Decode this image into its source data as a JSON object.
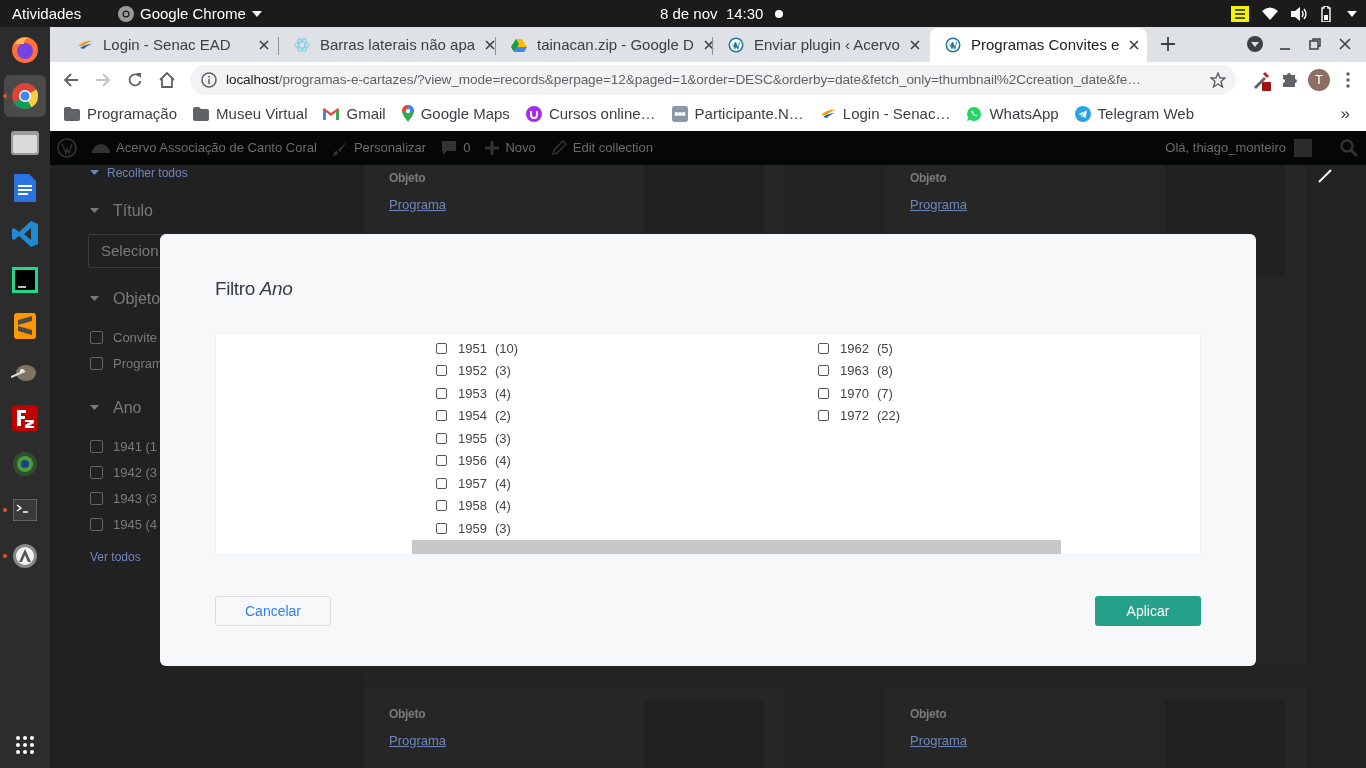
{
  "top_bar": {
    "activities": "Atividades",
    "app": "Google Chrome",
    "clock": "8 de nov  14:30"
  },
  "dock": [
    {
      "kind": "firefox",
      "selected": false,
      "running": false
    },
    {
      "kind": "chrome",
      "selected": true,
      "running": true
    },
    {
      "kind": "files",
      "selected": false,
      "running": false
    },
    {
      "kind": "docs",
      "selected": false,
      "running": false
    },
    {
      "kind": "vscode",
      "selected": false,
      "running": false
    },
    {
      "kind": "pycharm",
      "selected": false,
      "running": false
    },
    {
      "kind": "sublime",
      "selected": false,
      "running": false
    },
    {
      "kind": "gimp",
      "selected": false,
      "running": false
    },
    {
      "kind": "filezilla",
      "selected": false,
      "running": false
    },
    {
      "kind": "globe",
      "selected": false,
      "running": false
    },
    {
      "kind": "terminal",
      "selected": false,
      "running": true
    },
    {
      "kind": "updater",
      "selected": false,
      "running": true
    },
    {
      "kind": "apps",
      "selected": false,
      "running": false
    }
  ],
  "browser": {
    "tabs": [
      {
        "kind": "senac",
        "title": "Login - Senac EAD",
        "selected": false
      },
      {
        "kind": "react",
        "title": "Barras laterais não apa",
        "selected": false
      },
      {
        "kind": "drive",
        "title": "tainacan.zip - Google D",
        "selected": false
      },
      {
        "kind": "wordpress",
        "title": "Enviar plugin ‹ Acervo",
        "selected": false
      },
      {
        "kind": "wordpress",
        "title": "Programas Convites e",
        "selected": true
      }
    ],
    "url": {
      "host": "localhost",
      "path": "/programas-e-cartazes/?view_mode=records&perpage=12&paged=1&order=DESC&orderby=date&fetch_only=thumbnail%2Ccreation_date&fe…"
    },
    "avatar": "T",
    "bookmarks": [
      {
        "kind": "folder",
        "label": "Programação"
      },
      {
        "kind": "folder",
        "label": "Museu Virtual"
      },
      {
        "kind": "gmail",
        "label": "Gmail"
      },
      {
        "kind": "maps",
        "label": "Google Maps"
      },
      {
        "kind": "courses",
        "label": "Cursos online…"
      },
      {
        "kind": "meeting",
        "label": "Participante.N…"
      },
      {
        "kind": "senac",
        "label": "Login - Senac…"
      },
      {
        "kind": "whatsapp",
        "label": "WhatsApp"
      },
      {
        "kind": "telegram",
        "label": "Telegram Web"
      }
    ],
    "more": "»"
  },
  "admin_bar": {
    "site": "Acervo Associação de Canto Coral",
    "customize": "Personalizar",
    "comments": "0",
    "new": "Novo",
    "edit": "Edit collection",
    "greeting": "Olá, thiago_monteiro"
  },
  "sidebar": {
    "collapse": "Recolher todos",
    "filters": [
      {
        "kind": "select",
        "title": "Título",
        "placeholder": "Selecion"
      },
      {
        "kind": "checkboxes",
        "title": "Objeto",
        "options": [
          {
            "label": "Convite",
            "checked": false
          },
          {
            "label": "Program",
            "checked": false
          }
        ]
      },
      {
        "kind": "checkboxes",
        "title": "Ano",
        "options": [
          {
            "label": "1941 (1",
            "checked": false
          },
          {
            "label": "1942 (3",
            "checked": false
          },
          {
            "label": "1943 (3",
            "checked": false
          },
          {
            "label": "1945 (4",
            "checked": false
          }
        ],
        "more": "Ver todos"
      }
    ]
  },
  "cards": [
    {
      "label": "Objeto",
      "value": "Programa"
    },
    {
      "label": "Objeto",
      "value": "Programa"
    },
    {
      "label": "Objeto",
      "value": "Programa"
    },
    {
      "label": "Objeto",
      "value": "Programa"
    }
  ],
  "modal": {
    "title": "Filtro *Ano*",
    "columns": [
      [
        {
          "year": "1951",
          "count": "(10)",
          "checked": false
        },
        {
          "year": "1952",
          "count": "(3)",
          "checked": false
        },
        {
          "year": "1953",
          "count": "(4)",
          "checked": false
        },
        {
          "year": "1954",
          "count": "(2)",
          "checked": false
        },
        {
          "year": "1955",
          "count": "(3)",
          "checked": false
        },
        {
          "year": "1956",
          "count": "(4)",
          "checked": false
        },
        {
          "year": "1957",
          "count": "(4)",
          "checked": false
        },
        {
          "year": "1958",
          "count": "(4)",
          "checked": false
        },
        {
          "year": "1959",
          "count": "(3)",
          "checked": false
        }
      ],
      [
        {
          "year": "1962",
          "count": "(5)",
          "checked": false
        },
        {
          "year": "1963",
          "count": "(8)",
          "checked": false
        },
        {
          "year": "1970",
          "count": "(7)",
          "checked": false
        },
        {
          "year": "1972",
          "count": "(22)",
          "checked": false
        }
      ]
    ],
    "cancel": "Cancelar",
    "apply": "Aplicar"
  }
}
